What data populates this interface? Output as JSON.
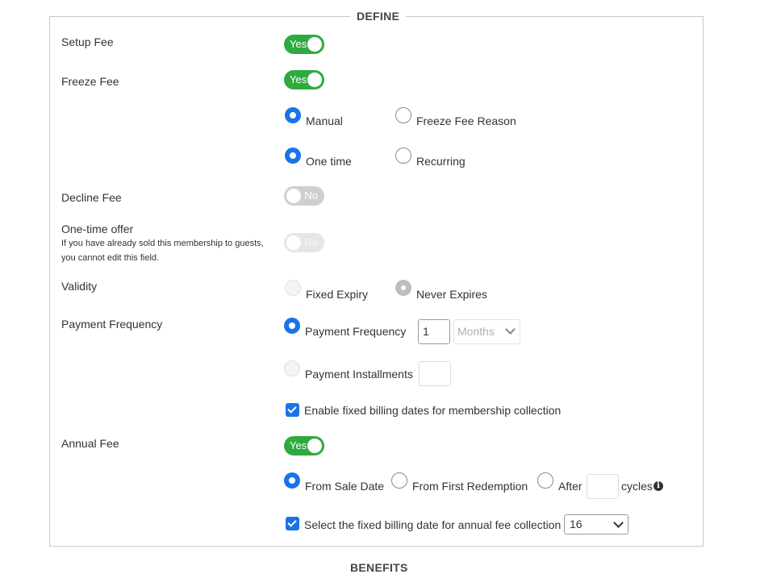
{
  "section": {
    "title": "DEFINE",
    "next_title": "BENEFITS"
  },
  "setup_fee": {
    "label": "Setup Fee",
    "toggle": "Yes"
  },
  "freeze_fee": {
    "label": "Freeze Fee",
    "toggle": "Yes",
    "manual": "Manual",
    "reason": "Freeze Fee Reason",
    "one_time": "One time",
    "recurring": "Recurring"
  },
  "decline_fee": {
    "label": "Decline Fee",
    "toggle": "No"
  },
  "one_time_offer": {
    "label": "One-time offer",
    "note": "If you have already sold this membership to guests, you cannot edit this field.",
    "toggle": "No"
  },
  "validity": {
    "label": "Validity",
    "fixed": "Fixed Expiry",
    "never": "Never Expires"
  },
  "payment": {
    "label": "Payment Frequency",
    "freq_option": "Payment Frequency",
    "freq_value": "1",
    "freq_unit": "Months",
    "installments_option": "Payment Installments",
    "installments_value": "",
    "fixed_billing": "Enable fixed billing dates for membership collection"
  },
  "annual_fee": {
    "label": "Annual Fee",
    "toggle": "Yes",
    "from_sale": "From Sale Date",
    "from_redemption": "From First Redemption",
    "after": "After",
    "cycles_value": "",
    "cycles": "cycles",
    "fixed_date_label": "Select the fixed billing date for annual fee collection",
    "fixed_date_value": "16"
  },
  "colors": {
    "accent": "#1a73e8",
    "toggle_on": "#2eaa3f",
    "toggle_off": "#cfcfcf"
  },
  "icons": {
    "info": "info-circle-icon"
  }
}
